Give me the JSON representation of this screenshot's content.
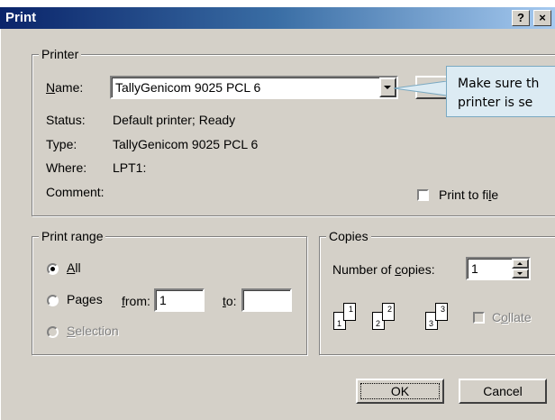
{
  "dialog": {
    "title": "Print",
    "help_btn": "?",
    "close_btn": "×"
  },
  "printer": {
    "group_label": "Printer",
    "name_label_u": "N",
    "name_label_rest": "ame:",
    "name_value": "TallyGenicom 9025 PCL 6",
    "status_label": "Status:",
    "status_value": "Default printer; Ready",
    "type_label": "Type:",
    "type_value": "TallyGenicom 9025 PCL 6",
    "where_label": "Where:",
    "where_value": "LPT1:",
    "comment_label": "Comment:",
    "print_to_file_pre": "Print to fi",
    "print_to_file_u": "l",
    "print_to_file_post": "e"
  },
  "callout": {
    "line1": "Make sure th",
    "line2": "printer is se"
  },
  "print_range": {
    "group_label": "Print range",
    "all_u": "A",
    "all_rest": "ll",
    "pages_pre": "Pa",
    "pages_u": "g",
    "pages_post": "es",
    "from_u": "f",
    "from_rest": "rom:",
    "from_value": "1",
    "to_u": "t",
    "to_rest": "o:",
    "to_value": "",
    "selection_u": "S",
    "selection_rest": "election"
  },
  "copies": {
    "group_label": "Copies",
    "number_pre": "Number of ",
    "number_u": "c",
    "number_post": "opies:",
    "number_value": "1",
    "collate_pre": "C",
    "collate_u": "o",
    "collate_post": "llate",
    "page_labels": [
      "1",
      "1",
      "2",
      "2",
      "3",
      "3"
    ]
  },
  "buttons": {
    "ok": "OK",
    "cancel": "Cancel"
  }
}
